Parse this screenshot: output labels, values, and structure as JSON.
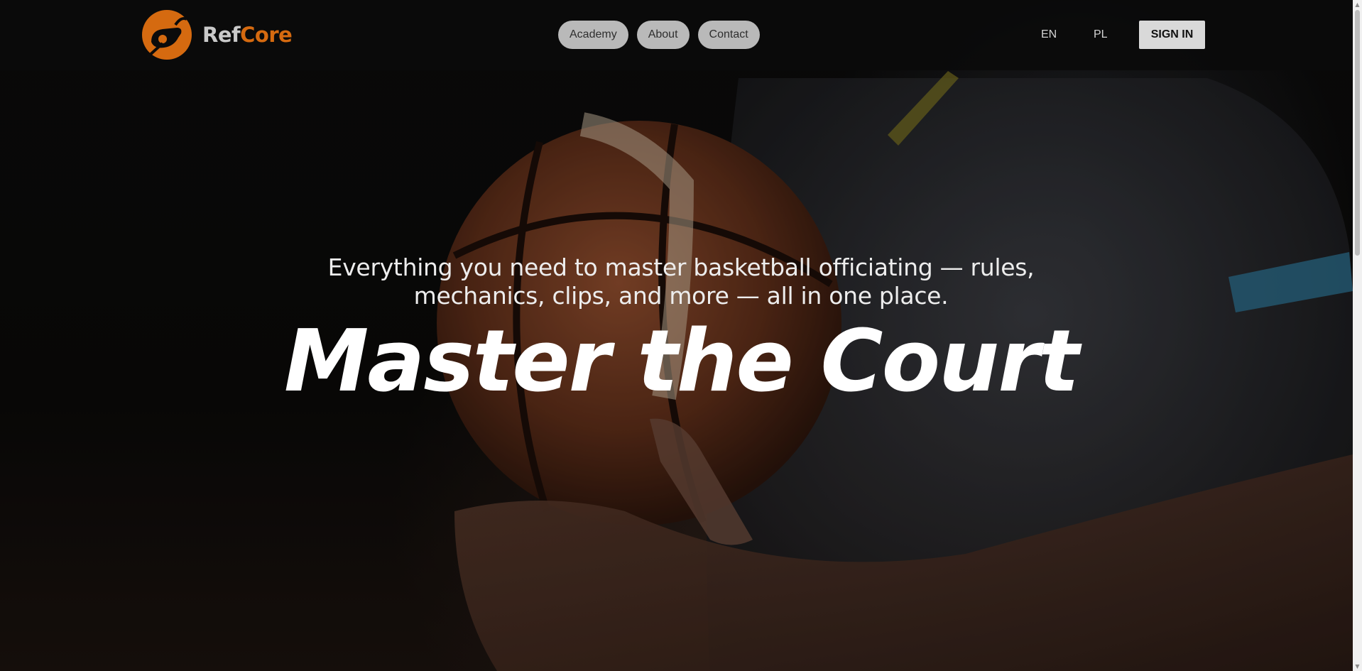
{
  "brand": {
    "name_part1": "Ref",
    "name_part2": "Core",
    "logo_icon": "whistle-logo-icon",
    "accent_color": "#d56a10"
  },
  "nav": {
    "items": [
      {
        "label": "Academy"
      },
      {
        "label": "About"
      },
      {
        "label": "Contact"
      }
    ]
  },
  "language": {
    "options": [
      "EN",
      "PL"
    ]
  },
  "auth": {
    "sign_in_label": "SIGN IN"
  },
  "hero": {
    "subtitle": "Everything you need to master basketball officiating — rules, mechanics, clips, and more — all in one place.",
    "headline": "Master the Court",
    "background_image": "referee holding basketball"
  },
  "scrollbar": {
    "up_icon": "▲",
    "down_icon": "▼"
  }
}
